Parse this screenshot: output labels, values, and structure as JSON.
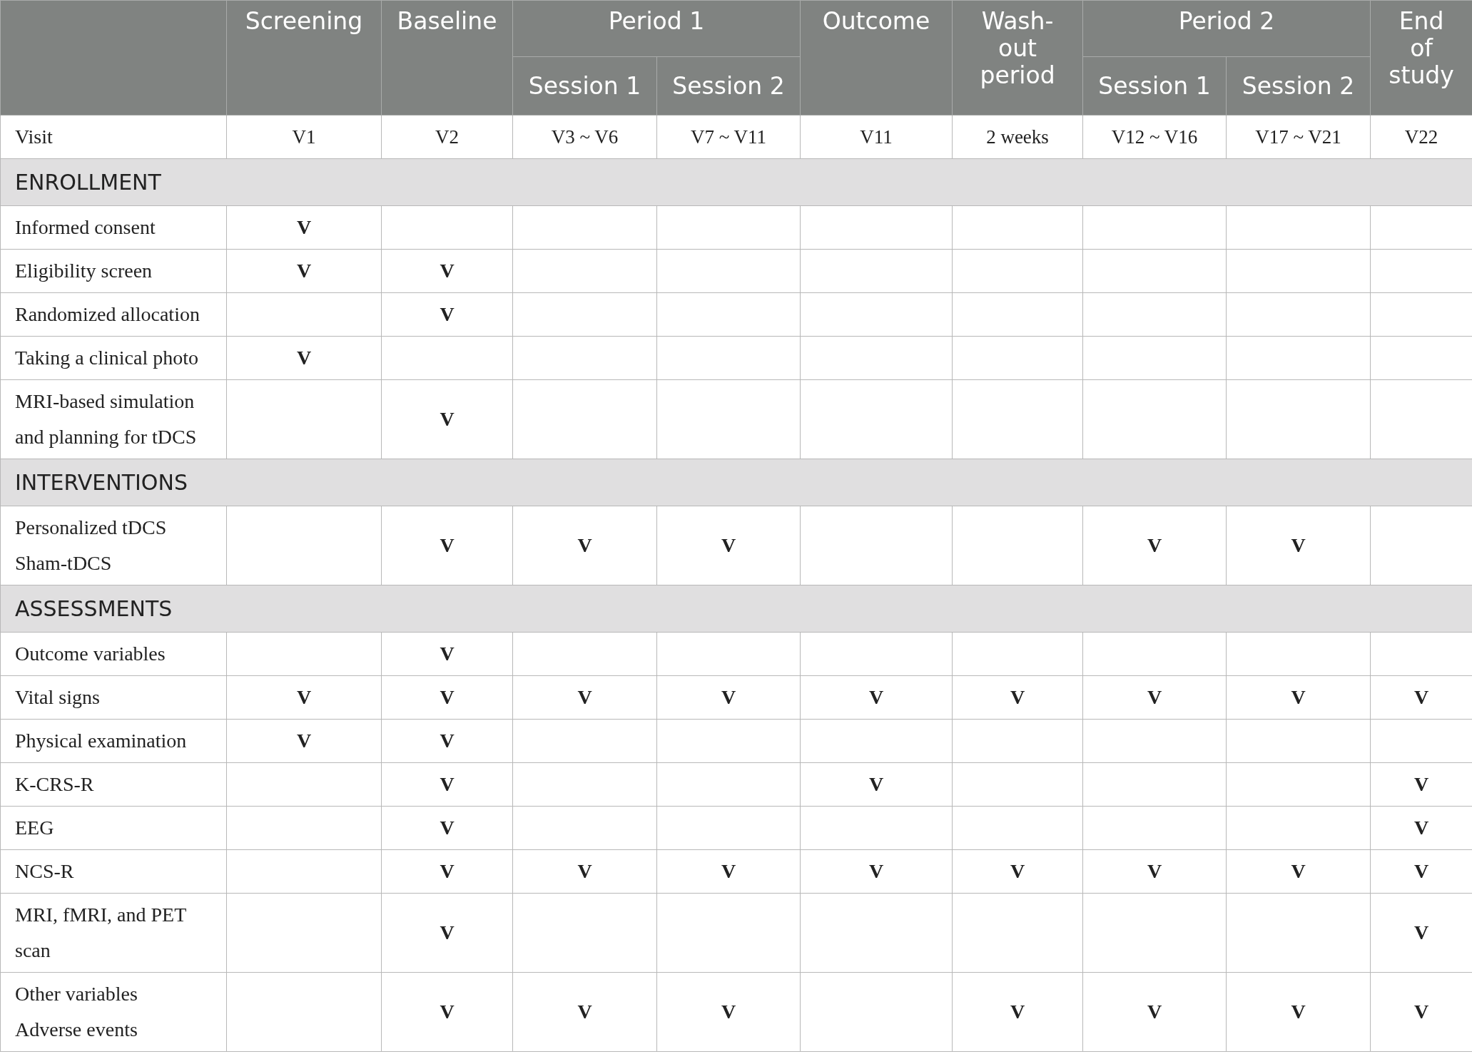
{
  "header": [
    {
      "lines": [
        "Screening"
      ]
    },
    {
      "lines": [
        "Baseline"
      ]
    },
    {
      "lines": [
        "Period 1"
      ],
      "subcolumns": [
        "Session 1",
        "Session 2"
      ]
    },
    {
      "lines": [
        "Outcome"
      ]
    },
    {
      "lines": [
        "Wash-",
        "out",
        "period"
      ]
    },
    {
      "lines": [
        "Period 2"
      ],
      "subcolumns": [
        "Session 1",
        "Session 2"
      ]
    },
    {
      "lines": [
        "End",
        "of",
        "study"
      ]
    }
  ],
  "visit_row": {
    "label": "Visit",
    "cells": [
      "V1",
      "V2",
      "V3 ~ V6",
      "V7 ~ V11",
      "V11",
      "2 weeks",
      "V12 ~ V16",
      "V17 ~ V21",
      "V22"
    ]
  },
  "sections": [
    {
      "title": "ENROLLMENT",
      "rows": [
        {
          "lines": [
            "Informed consent"
          ],
          "cells": [
            "V",
            "",
            "",
            "",
            "",
            "",
            "",
            "",
            ""
          ]
        },
        {
          "lines": [
            "Eligibility screen"
          ],
          "cells": [
            "V",
            "V",
            "",
            "",
            "",
            "",
            "",
            "",
            ""
          ]
        },
        {
          "lines": [
            "Randomized allocation"
          ],
          "cells": [
            "",
            "V",
            "",
            "",
            "",
            "",
            "",
            "",
            ""
          ]
        },
        {
          "lines": [
            "Taking a clinical photo"
          ],
          "cells": [
            "V",
            "",
            "",
            "",
            "",
            "",
            "",
            "",
            ""
          ]
        },
        {
          "lines": [
            "MRI-based simulation",
            "and planning for tDCS"
          ],
          "cells": [
            "",
            "V",
            "",
            "",
            "",
            "",
            "",
            "",
            ""
          ]
        }
      ]
    },
    {
      "title": "INTERVENTIONS",
      "rows": [
        {
          "lines": [
            "Personalized tDCS",
            "Sham-tDCS"
          ],
          "cells": [
            "",
            "V",
            "V",
            "V",
            "",
            "",
            "V",
            "V",
            ""
          ]
        }
      ]
    },
    {
      "title": "ASSESSMENTS",
      "rows": [
        {
          "lines": [
            "Outcome variables"
          ],
          "cells": [
            "",
            "V",
            "",
            "",
            "",
            "",
            "",
            "",
            ""
          ]
        },
        {
          "lines": [
            "Vital signs"
          ],
          "cells": [
            "V",
            "V",
            "V",
            "V",
            "V",
            "V",
            "V",
            "V",
            "V"
          ]
        },
        {
          "lines": [
            "Physical examination"
          ],
          "cells": [
            "V",
            "V",
            "",
            "",
            "",
            "",
            "",
            "",
            ""
          ]
        },
        {
          "lines": [
            "K-CRS-R"
          ],
          "cells": [
            "",
            "V",
            "",
            "",
            "V",
            "",
            "",
            "",
            "V"
          ]
        },
        {
          "lines": [
            "EEG"
          ],
          "cells": [
            "",
            "V",
            "",
            "",
            "",
            "",
            "",
            "",
            "V"
          ]
        },
        {
          "lines": [
            "NCS-R"
          ],
          "cells": [
            "",
            "V",
            "V",
            "V",
            "V",
            "V",
            "V",
            "V",
            "V"
          ]
        },
        {
          "lines": [
            "MRI, fMRI, and PET",
            "scan"
          ],
          "cells": [
            "",
            "V",
            "",
            "",
            "",
            "",
            "",
            "",
            "V"
          ]
        },
        {
          "lines": [
            "Other variables",
            "Adverse events"
          ],
          "cells": [
            "",
            "V",
            "V",
            "V",
            "",
            "V",
            "V",
            "V",
            "V"
          ]
        }
      ]
    }
  ]
}
